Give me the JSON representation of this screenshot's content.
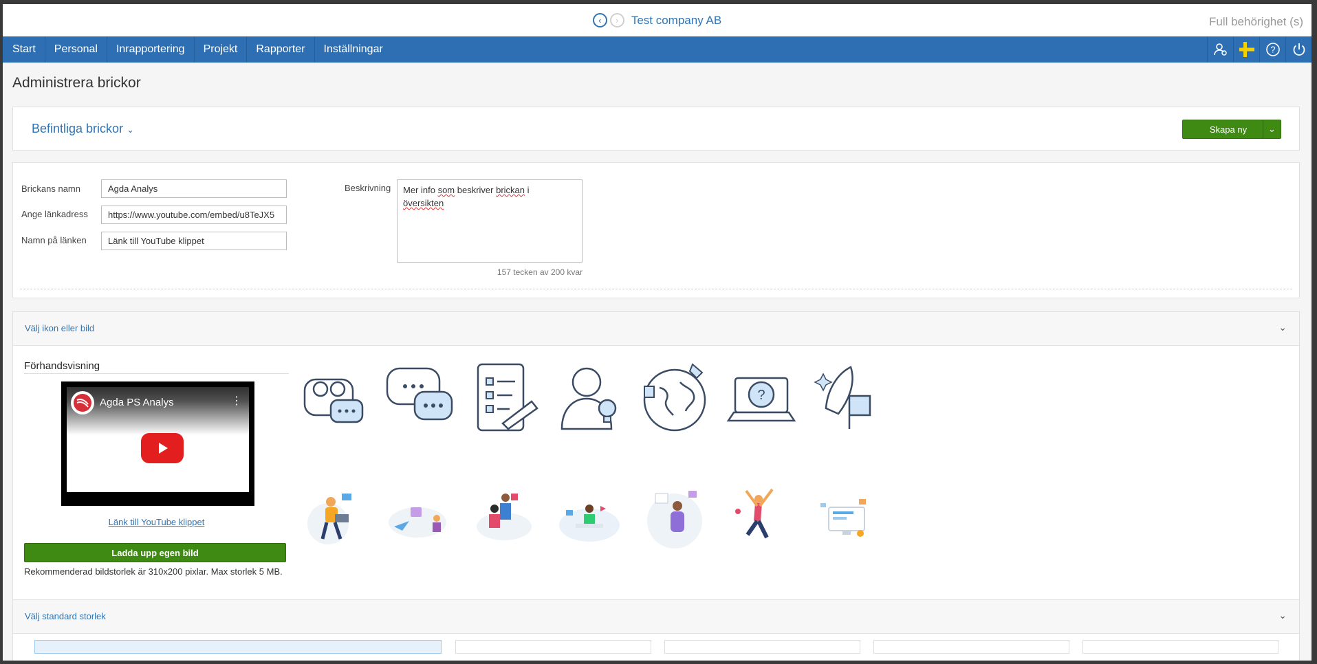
{
  "header": {
    "company": "Test company AB",
    "permission": "Full behörighet (s)",
    "back_icon": "chevron-left-icon",
    "forward_icon": "chevron-right-icon"
  },
  "nav": {
    "items": [
      "Start",
      "Personal",
      "Inrapportering",
      "Projekt",
      "Rapporter",
      "Inställningar"
    ],
    "icons": [
      "user-settings-icon",
      "swedish-flag-icon",
      "help-icon",
      "power-icon"
    ]
  },
  "page": {
    "title": "Administrera brickor"
  },
  "existing": {
    "label": "Befintliga brickor",
    "create_label": "Skapa ny"
  },
  "form": {
    "name_label": "Brickans namn",
    "name_value": "Agda Analys",
    "url_label": "Ange länkadress",
    "url_value": "https://www.youtube.com/embed/u8TeJX5",
    "linkname_label": "Namn på länken",
    "linkname_value": "Länk till YouTube klippet",
    "desc_label": "Beskrivning",
    "desc_value_1": "Mer info ",
    "desc_value_2": "som",
    "desc_value_3": " beskriver ",
    "desc_value_4": "brickan",
    "desc_value_5": " i",
    "desc_value_6": "översikten",
    "counter": "157 tecken av 200 kvar"
  },
  "icon_section": {
    "title": "Välj ikon eller bild",
    "preview_title": "Förhandsvisning",
    "video_title": "Agda PS Analys",
    "link_text": "Länk till YouTube klippet",
    "upload_label": "Ladda upp egen bild",
    "recommendation": "Rekommenderad bildstorlek är 310x200 pixlar. Max storlek 5 MB."
  },
  "size_section": {
    "title": "Välj standard storlek"
  },
  "colors": {
    "primary": "#2f74b5",
    "nav": "#2e6fb3",
    "green": "#3f8a12"
  }
}
